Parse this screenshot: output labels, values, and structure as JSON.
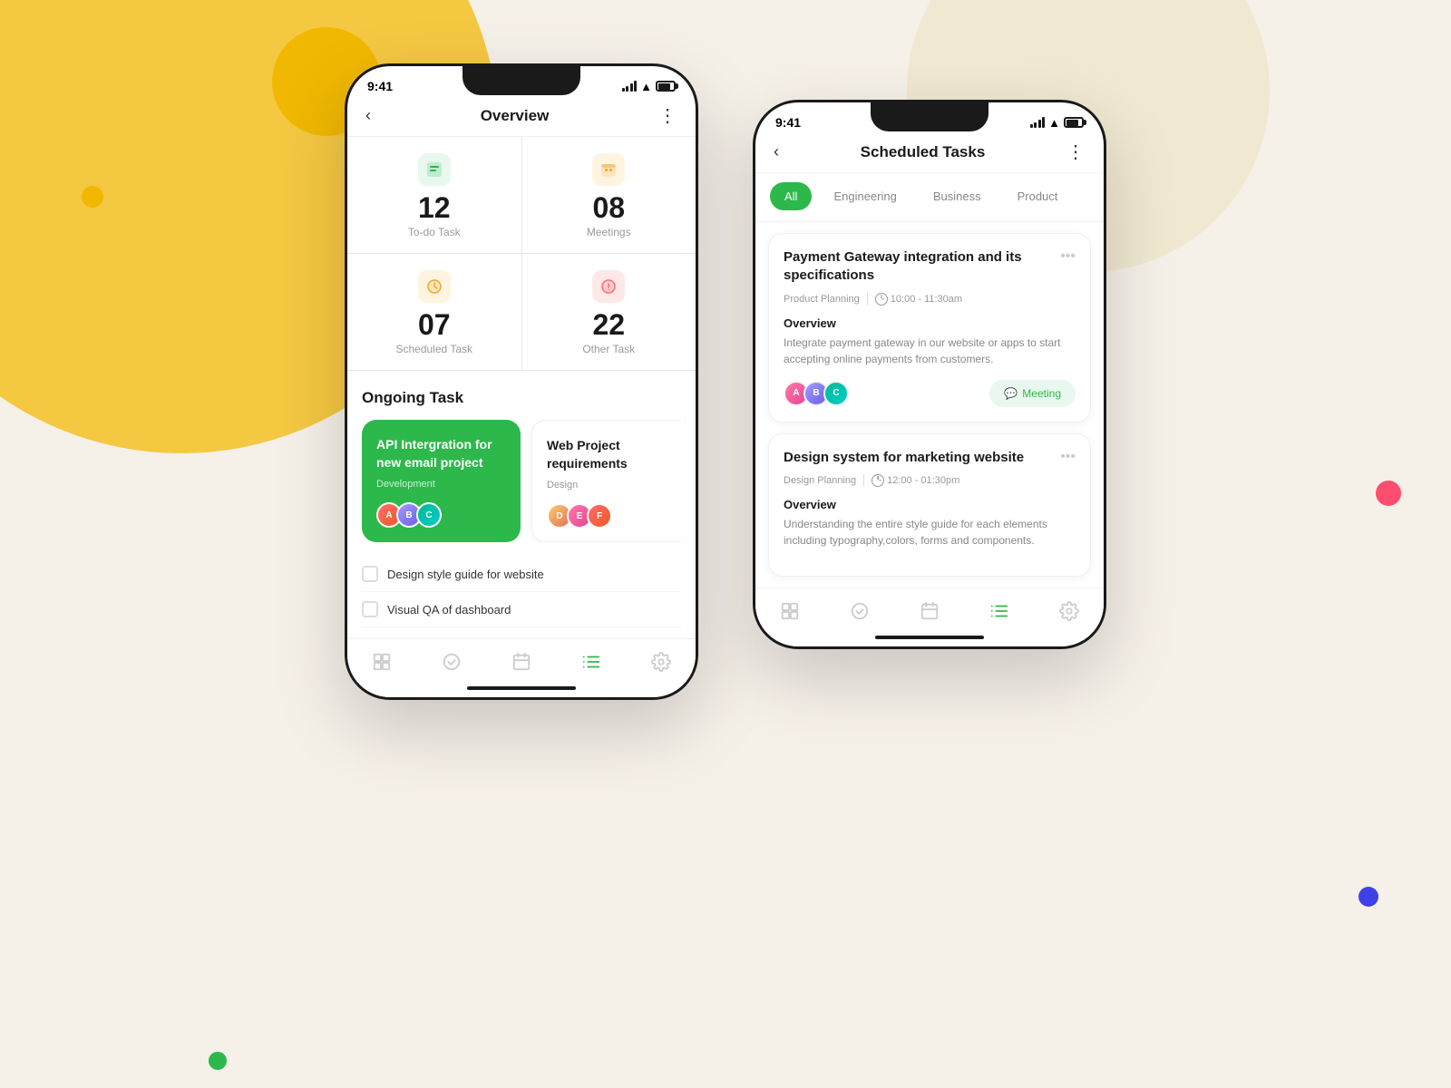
{
  "background": {
    "colors": {
      "main": "#f5f0e8",
      "yellow_large": "#f5c842",
      "yellow_small": "#f0b800",
      "cream": "#f0e8d0",
      "dot_pink": "#ff4d6d",
      "dot_blue": "#4040e8",
      "dot_green": "#2db84b"
    }
  },
  "phone1": {
    "status_bar": {
      "time": "9:41"
    },
    "nav": {
      "title": "Overview",
      "back_label": "‹",
      "more_label": "⋮"
    },
    "stats": [
      {
        "icon": "📋",
        "icon_bg": "#e8f8ee",
        "number": "12",
        "label": "To-do Task"
      },
      {
        "icon": "📅",
        "icon_bg": "#fff4e0",
        "number": "08",
        "label": "Meetings"
      },
      {
        "icon": "⏰",
        "icon_bg": "#fff4e0",
        "number": "07",
        "label": "Scheduled Task"
      },
      {
        "icon": "❓",
        "icon_bg": "#ffe8e8",
        "number": "22",
        "label": "Other Task"
      }
    ],
    "ongoing_section": {
      "title": "Ongoing Task"
    },
    "task_cards": [
      {
        "title": "API Intergration for new email project",
        "tag": "Development",
        "style": "green"
      },
      {
        "title": "Web Project requirements",
        "tag": "Design",
        "style": "white"
      }
    ],
    "checklist": [
      "Design style guide for website",
      "Visual QA of dashboard"
    ],
    "bottom_nav": [
      "grid",
      "check",
      "calendar",
      "list",
      "settings"
    ]
  },
  "phone2": {
    "status_bar": {
      "time": "9:41"
    },
    "nav": {
      "title": "Scheduled Tasks",
      "back_label": "‹",
      "more_label": "⋮"
    },
    "filter_tabs": [
      {
        "label": "All",
        "active": true
      },
      {
        "label": "Engineering",
        "active": false
      },
      {
        "label": "Business",
        "active": false
      },
      {
        "label": "Product",
        "active": false
      }
    ],
    "tasks": [
      {
        "title": "Payment Gateway integration and its specifications",
        "category": "Product Planning",
        "time": "10:00 - 11:30am",
        "overview_label": "Overview",
        "overview_text": "Integrate payment gateway in our website or apps to start accepting online payments from customers.",
        "action_label": "Meeting",
        "action_icon": "💬"
      },
      {
        "title": "Design system for marketing website",
        "category": "Design Planning",
        "time": "12:00 - 01:30pm",
        "overview_label": "Overview",
        "overview_text": "Understanding the entire style guide for each elements including typography,colors, forms and components.",
        "action_label": "",
        "action_icon": ""
      }
    ],
    "bottom_nav": [
      "grid",
      "check",
      "calendar",
      "list-active",
      "settings"
    ]
  }
}
